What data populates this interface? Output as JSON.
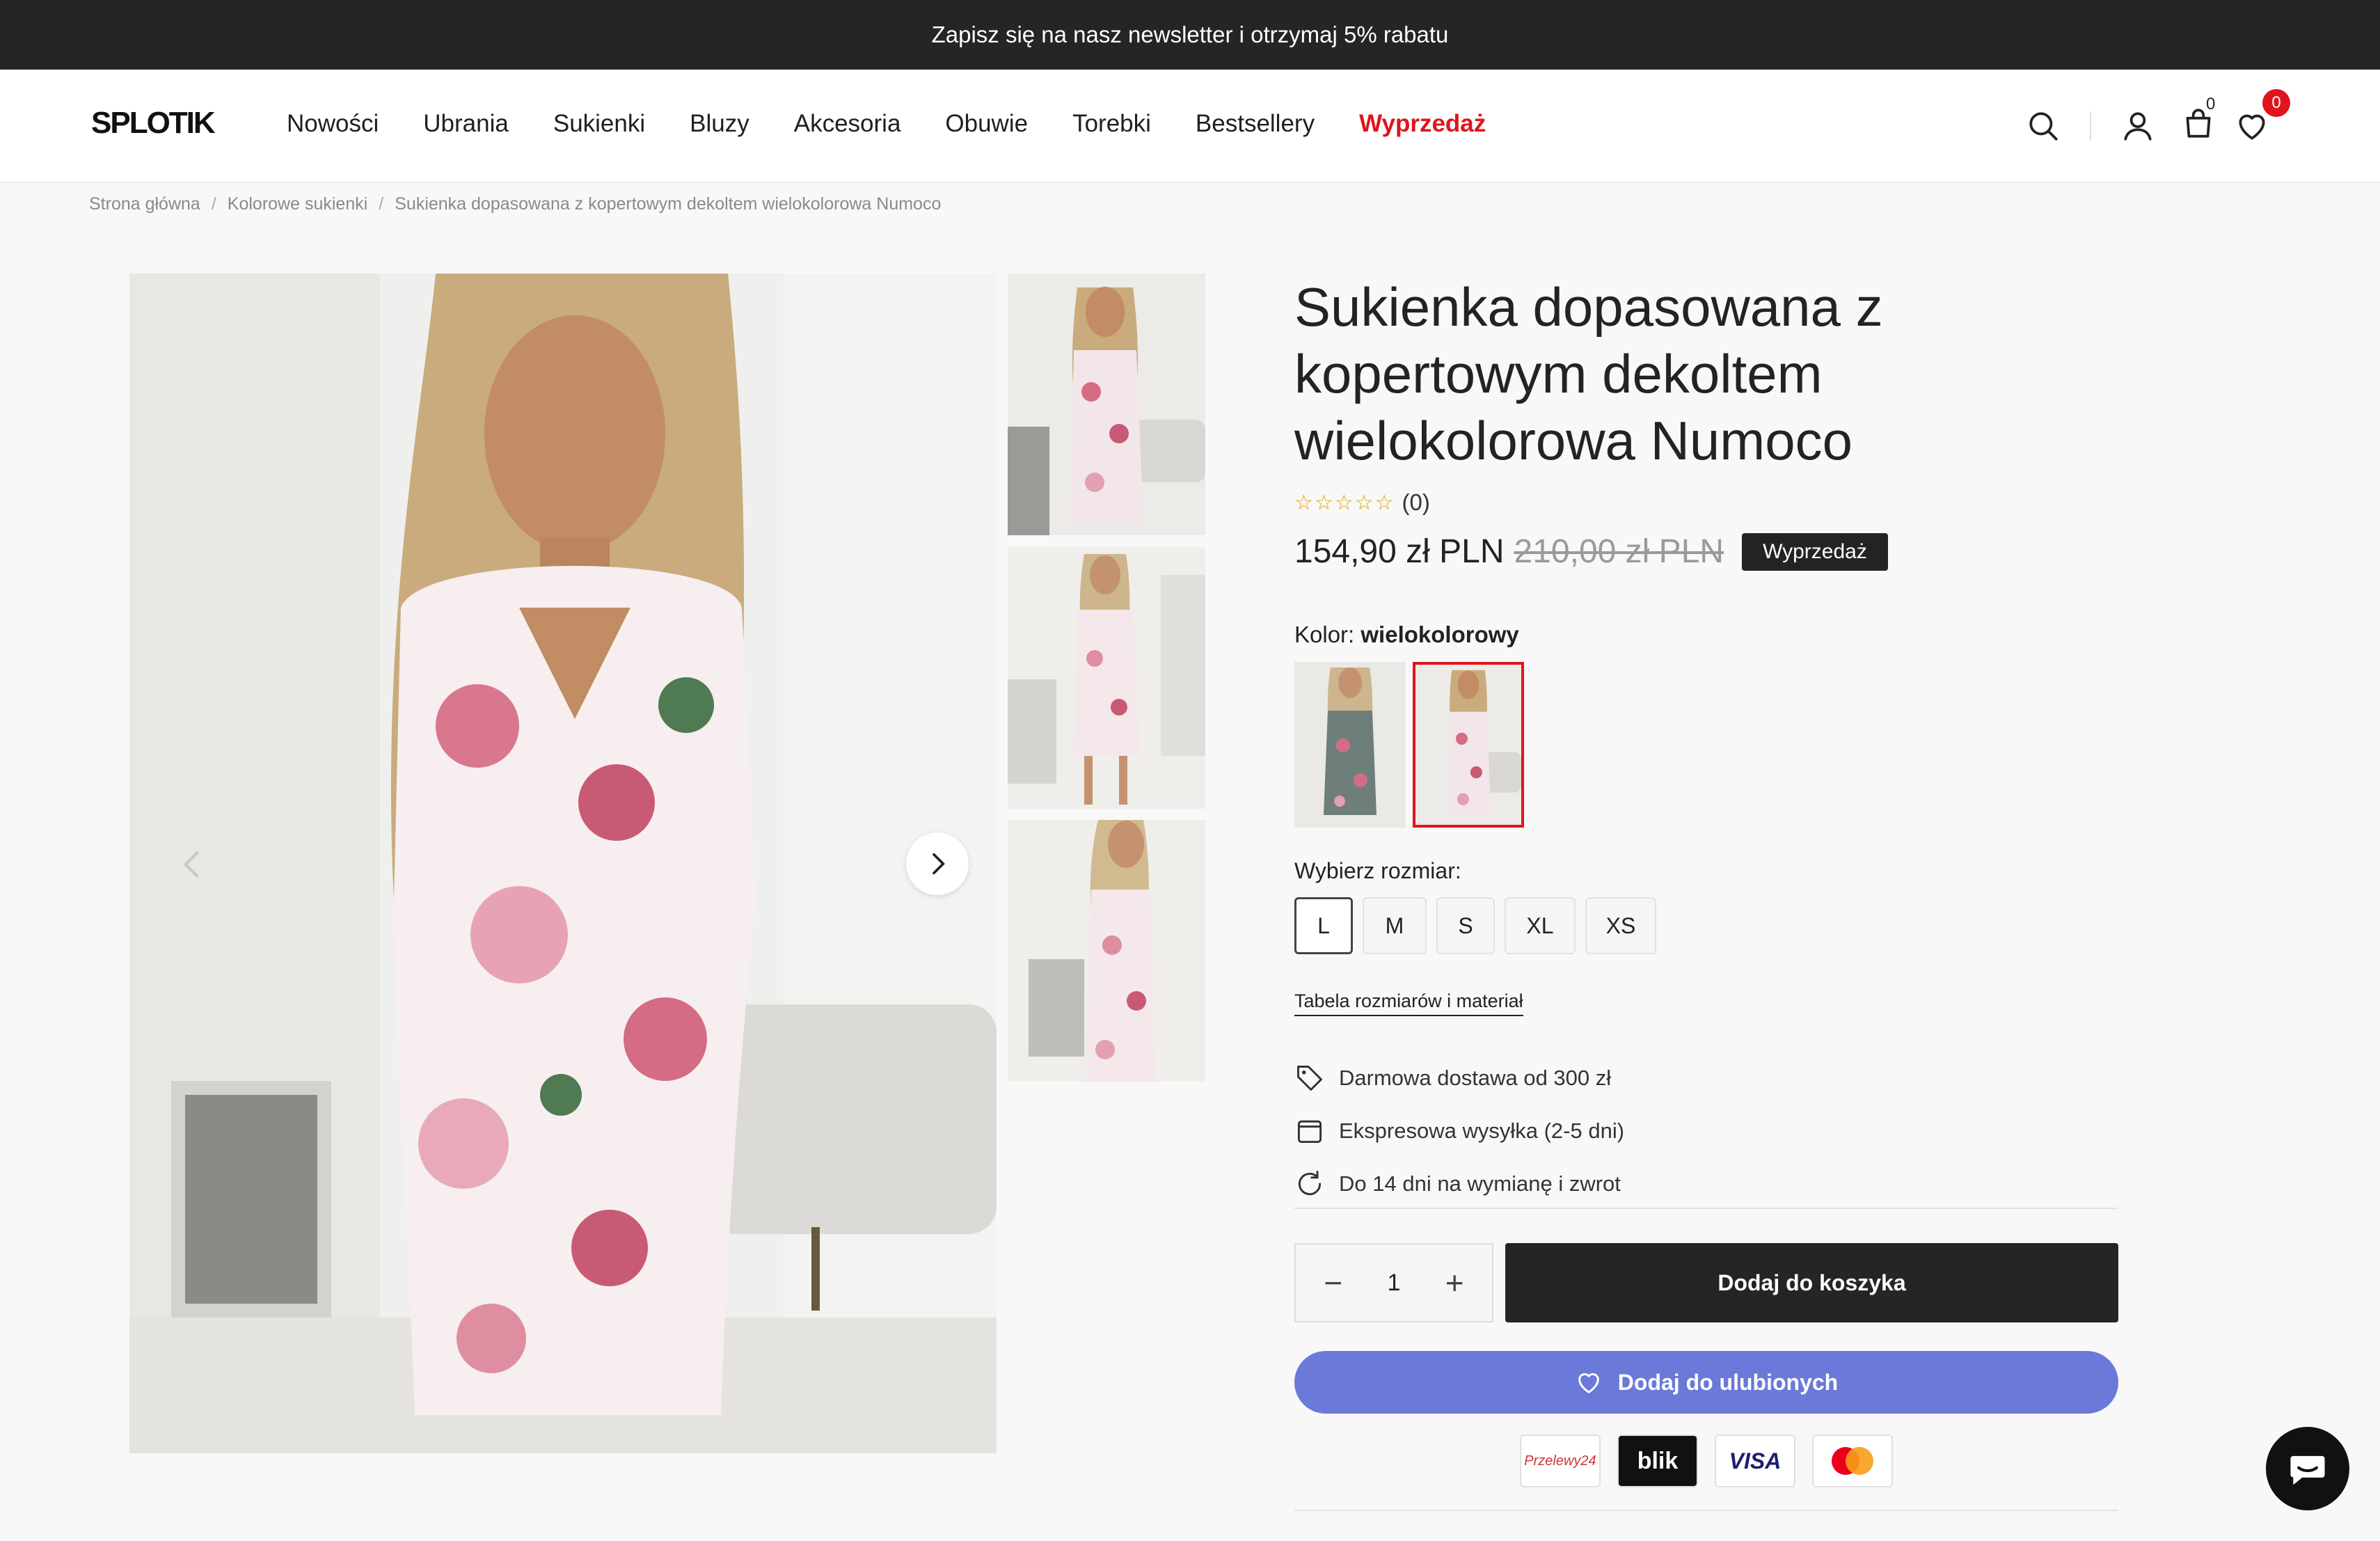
{
  "announcement": "Zapisz się na nasz newsletter i otrzymaj 5% rabatu",
  "header": {
    "logo": "SPLOTIK",
    "nav": [
      {
        "label": "Nowości"
      },
      {
        "label": "Ubrania"
      },
      {
        "label": "Sukienki"
      },
      {
        "label": "Bluzy"
      },
      {
        "label": "Akcesoria"
      },
      {
        "label": "Obuwie"
      },
      {
        "label": "Torebki"
      },
      {
        "label": "Bestsellery"
      },
      {
        "label": "Wyprzedaż",
        "highlight_color": "#e0141c"
      }
    ],
    "icons": [
      "search-icon",
      "account-icon",
      "bag-icon",
      "heart-icon"
    ],
    "cart_count": "0",
    "wishlist_count": "0"
  },
  "breadcrumb": [
    "Strona główna",
    "Kolorowe sukienki",
    "Sukienka dopasowana z kopertowym dekoltem wielokolorowa Numoco"
  ],
  "product": {
    "title": "Sukienka dopasowana z kopertowym dekoltem wielokolorowa Numoco",
    "rating_stars": 0,
    "rating_count": "(0)",
    "price": "154,90 zł PLN",
    "old_price": "210,00 zł PLN",
    "sale_badge": "Wyprzedaż",
    "color_label": "Kolor:",
    "color_value": "wielokolorowy",
    "size_label": "Wybierz rozmiar:",
    "sizes": [
      "L",
      "M",
      "S",
      "XL",
      "XS"
    ],
    "selected_size": "L",
    "size_table_link": "Tabela rozmiarów i materiał",
    "features": [
      {
        "icon": "tag-icon",
        "text": "Darmowa dostawa od 300 zł"
      },
      {
        "icon": "calendar-icon",
        "text": "Ekspresowa wysyłka (2-5 dni)"
      },
      {
        "icon": "refresh-icon",
        "text": "Do 14 dni na wymianę i zwrot"
      }
    ],
    "quantity": "1",
    "add_to_cart": "Dodaj do koszyka",
    "add_to_wishlist": "Dodaj do ulubionych",
    "wishlist_button_color": "#6b79d8",
    "payments": [
      "Przelewy24",
      "blik",
      "VISA",
      "mastercard"
    ]
  },
  "colors": {
    "accent_red": "#e0141c",
    "dark": "#252525"
  }
}
